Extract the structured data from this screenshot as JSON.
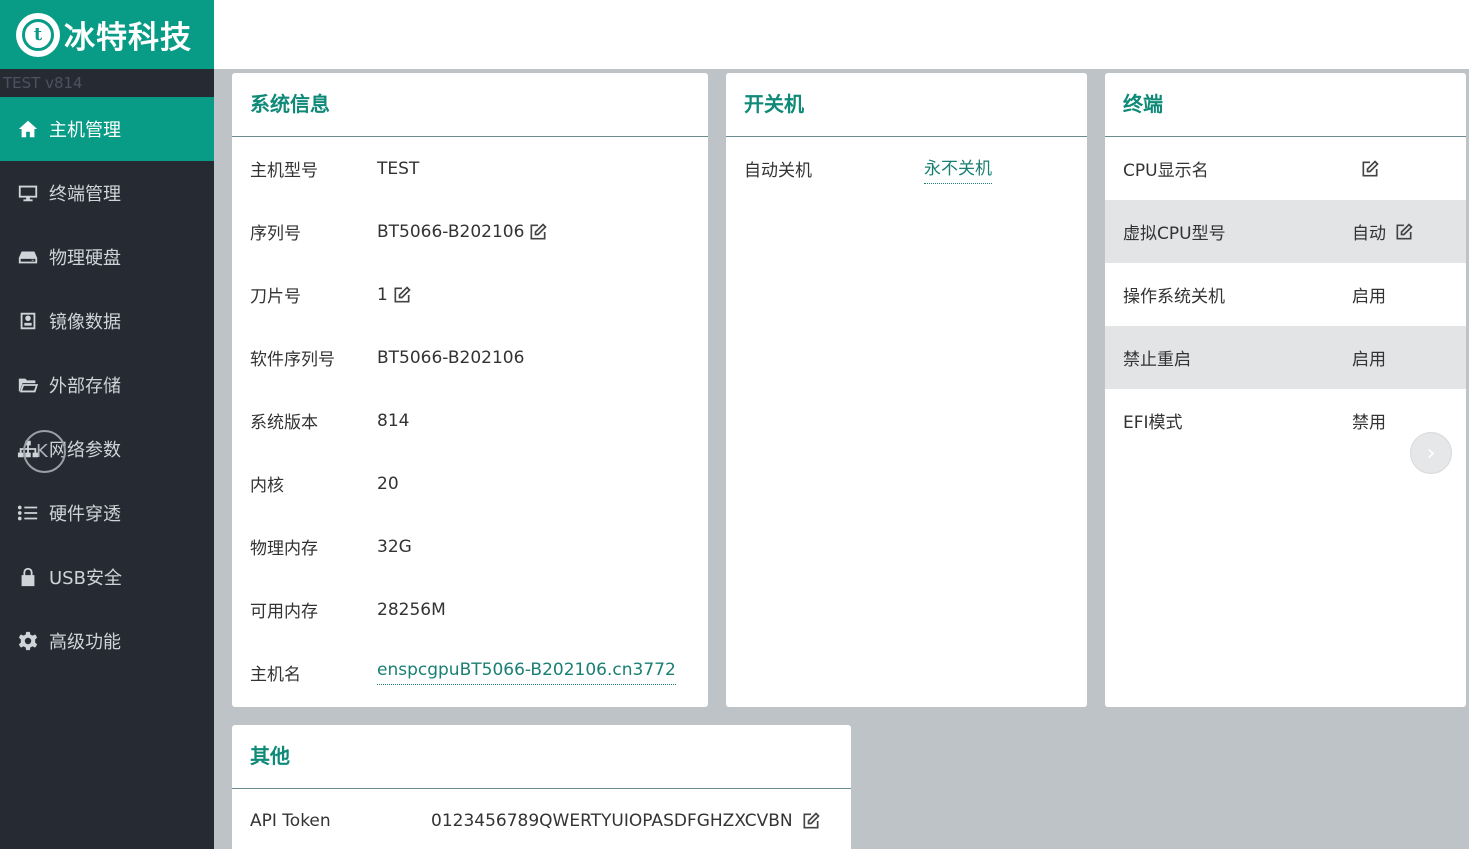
{
  "brand": {
    "logo_letter": "t",
    "name": "冰特科技",
    "version": "TEST v814"
  },
  "sidebar": {
    "items": [
      {
        "label": "主机管理",
        "icon": "home-icon"
      },
      {
        "label": "终端管理",
        "icon": "monitor-icon"
      },
      {
        "label": "物理硬盘",
        "icon": "harddisk-icon"
      },
      {
        "label": "镜像数据",
        "icon": "image-data-icon"
      },
      {
        "label": "外部存储",
        "icon": "folder-icon"
      },
      {
        "label": "网络参数",
        "icon": "network-icon"
      },
      {
        "label": "硬件穿透",
        "icon": "list-icon"
      },
      {
        "label": "USB安全",
        "icon": "lock-icon"
      },
      {
        "label": "高级功能",
        "icon": "gear-icon"
      }
    ],
    "active_index": 0
  },
  "system_info": {
    "title": "系统信息",
    "rows": [
      {
        "label": "主机型号",
        "value": "TEST"
      },
      {
        "label": "序列号",
        "value": "BT5066-B202106"
      },
      {
        "label": "刀片号",
        "value": "1"
      },
      {
        "label": "软件序列号",
        "value": "BT5066-B202106"
      },
      {
        "label": "系统版本",
        "value": "814"
      },
      {
        "label": "内核",
        "value": "20"
      },
      {
        "label": "物理内存",
        "value": "32G"
      },
      {
        "label": "可用内存",
        "value": "28256M"
      },
      {
        "label": "主机名",
        "value": "enspcgpuBT5066-B202106.cn3772"
      }
    ]
  },
  "power": {
    "title": "开关机",
    "rows": [
      {
        "label": "自动关机",
        "value": "永不关机"
      }
    ]
  },
  "terminal": {
    "title": "终端",
    "rows": [
      {
        "label": "CPU显示名",
        "value": ""
      },
      {
        "label": "虚拟CPU型号",
        "value": "自动"
      },
      {
        "label": "操作系统关机",
        "value": "启用"
      },
      {
        "label": "禁止重启",
        "value": "启用"
      },
      {
        "label": "EFI模式",
        "value": "禁用"
      }
    ]
  },
  "other": {
    "title": "其他",
    "rows": [
      {
        "label": "API Token",
        "value": "0123456789QWERTYUIOPASDFGHZXCVBN"
      }
    ]
  },
  "overlay": {
    "glyph": "K"
  },
  "colors": {
    "accent": "#089b86",
    "sidebar_bg": "#262b33",
    "link": "#1a7f73",
    "page_bg": "#bec3c7"
  }
}
